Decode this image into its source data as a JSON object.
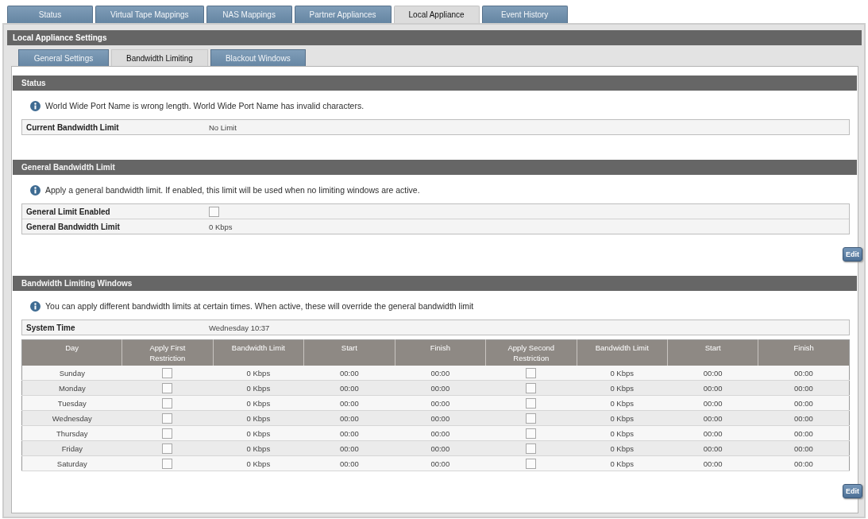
{
  "top_tabs": [
    {
      "label": "Status",
      "selected": false
    },
    {
      "label": "Virtual Tape Mappings",
      "selected": false
    },
    {
      "label": "NAS Mappings",
      "selected": false
    },
    {
      "label": "Partner Appliances",
      "selected": false
    },
    {
      "label": "Local Appliance",
      "selected": true
    },
    {
      "label": "Event History",
      "selected": false
    }
  ],
  "panel": {
    "title": "Local Appliance Settings",
    "tabs": [
      {
        "label": "General Settings",
        "selected": false
      },
      {
        "label": "Bandwidth Limiting",
        "selected": true
      },
      {
        "label": "Blackout Windows",
        "selected": false
      }
    ]
  },
  "sections": [
    {
      "title": "Status",
      "info": "World Wide Port Name is wrong length. World Wide Port Name has invalid characters.",
      "fields": [
        {
          "label": "Current Bandwidth Limit",
          "kind": "text",
          "value": "No Limit"
        }
      ]
    },
    {
      "title": "General Bandwidth Limit",
      "info": "Apply a general bandwidth limit. If enabled, this limit will be used when no limiting windows are active.",
      "fields": [
        {
          "label": "General Limit Enabled",
          "kind": "checkbox",
          "checked": false
        },
        {
          "label": "General Bandwidth Limit",
          "kind": "text",
          "value": "0 Kbps"
        }
      ],
      "button": "Edit"
    },
    {
      "title": "Bandwidth Limiting Windows",
      "info": "You can apply different bandwidth limits at certain times. When active, these will override the general bandwidth limit",
      "fields": [
        {
          "label": "System Time",
          "kind": "text",
          "value": "Wednesday 10:37"
        }
      ],
      "table": {
        "columns": [
          "Day",
          "Apply First Restriction",
          "Bandwidth Limit",
          "Start",
          "Finish",
          "Apply Second Restriction",
          "Bandwidth Limit",
          "Start",
          "Finish"
        ],
        "rows": [
          {
            "day": "Sunday",
            "restrictions": [
              {
                "checked": false,
                "limit": "0 Kbps",
                "start": "00:00",
                "finish": "00:00"
              },
              {
                "checked": false,
                "limit": "0 Kbps",
                "start": "00:00",
                "finish": "00:00"
              }
            ]
          },
          {
            "day": "Monday",
            "restrictions": [
              {
                "checked": false,
                "limit": "0 Kbps",
                "start": "00:00",
                "finish": "00:00"
              },
              {
                "checked": false,
                "limit": "0 Kbps",
                "start": "00:00",
                "finish": "00:00"
              }
            ]
          },
          {
            "day": "Tuesday",
            "restrictions": [
              {
                "checked": false,
                "limit": "0 Kbps",
                "start": "00:00",
                "finish": "00:00"
              },
              {
                "checked": false,
                "limit": "0 Kbps",
                "start": "00:00",
                "finish": "00:00"
              }
            ]
          },
          {
            "day": "Wednesday",
            "restrictions": [
              {
                "checked": false,
                "limit": "0 Kbps",
                "start": "00:00",
                "finish": "00:00"
              },
              {
                "checked": false,
                "limit": "0 Kbps",
                "start": "00:00",
                "finish": "00:00"
              }
            ]
          },
          {
            "day": "Thursday",
            "restrictions": [
              {
                "checked": false,
                "limit": "0 Kbps",
                "start": "00:00",
                "finish": "00:00"
              },
              {
                "checked": false,
                "limit": "0 Kbps",
                "start": "00:00",
                "finish": "00:00"
              }
            ]
          },
          {
            "day": "Friday",
            "restrictions": [
              {
                "checked": false,
                "limit": "0 Kbps",
                "start": "00:00",
                "finish": "00:00"
              },
              {
                "checked": false,
                "limit": "0 Kbps",
                "start": "00:00",
                "finish": "00:00"
              }
            ]
          },
          {
            "day": "Saturday",
            "restrictions": [
              {
                "checked": false,
                "limit": "0 Kbps",
                "start": "00:00",
                "finish": "00:00"
              },
              {
                "checked": false,
                "limit": "0 Kbps",
                "start": "00:00",
                "finish": "00:00"
              }
            ]
          }
        ]
      },
      "button": "Edit"
    }
  ]
}
